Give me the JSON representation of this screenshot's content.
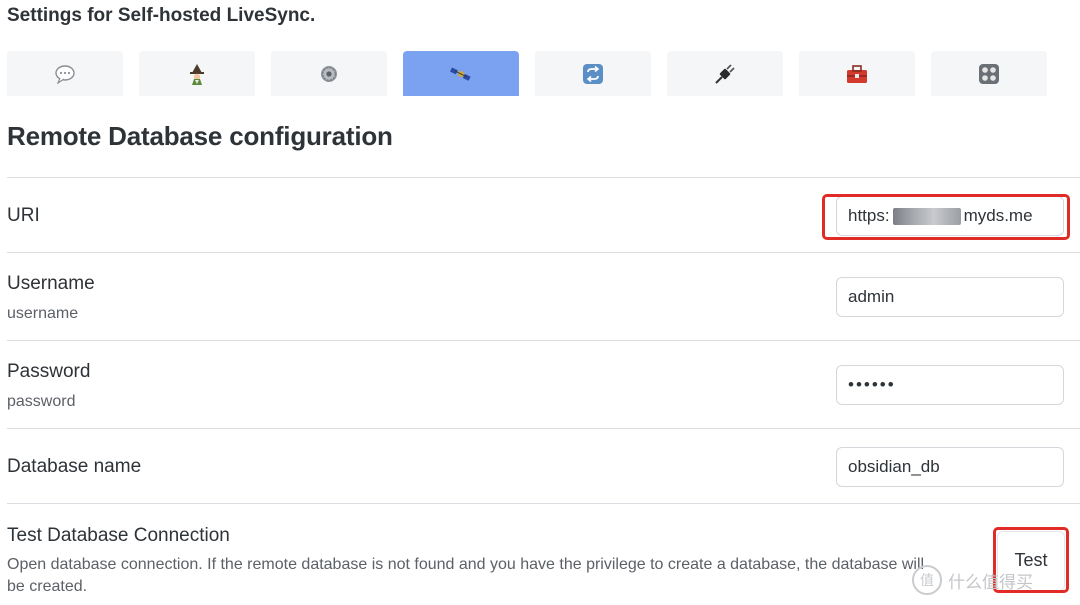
{
  "page_title": "Settings for Self-hosted LiveSync.",
  "tabs": [
    {
      "icon": "speech-bubble-icon",
      "active": false
    },
    {
      "icon": "wizard-icon",
      "active": false
    },
    {
      "icon": "gear-icon",
      "active": false
    },
    {
      "icon": "satellite-icon",
      "active": true
    },
    {
      "icon": "sync-arrows-icon",
      "active": false
    },
    {
      "icon": "plug-icon",
      "active": false
    },
    {
      "icon": "toolbox-icon",
      "active": false
    },
    {
      "icon": "control-knobs-icon",
      "active": false
    }
  ],
  "section_title": "Remote Database configuration",
  "fields": {
    "uri": {
      "label": "URI",
      "value_prefix": "https:",
      "value_suffix": "myds.me"
    },
    "username": {
      "label": "Username",
      "description": "username",
      "value": "admin"
    },
    "password": {
      "label": "Password",
      "description": "password",
      "value": "••••••"
    },
    "database_name": {
      "label": "Database name",
      "value": "obsidian_db"
    }
  },
  "test_connection": {
    "label": "Test Database Connection",
    "description": "Open database connection. If the remote database is not found and you have the privilege to create a database, the database will be created.",
    "button_label": "Test"
  },
  "watermark": {
    "text": "什么值得买",
    "glyph": "值"
  },
  "colors": {
    "active_tab": "#7aa2f0",
    "highlight": "#e02b26"
  }
}
